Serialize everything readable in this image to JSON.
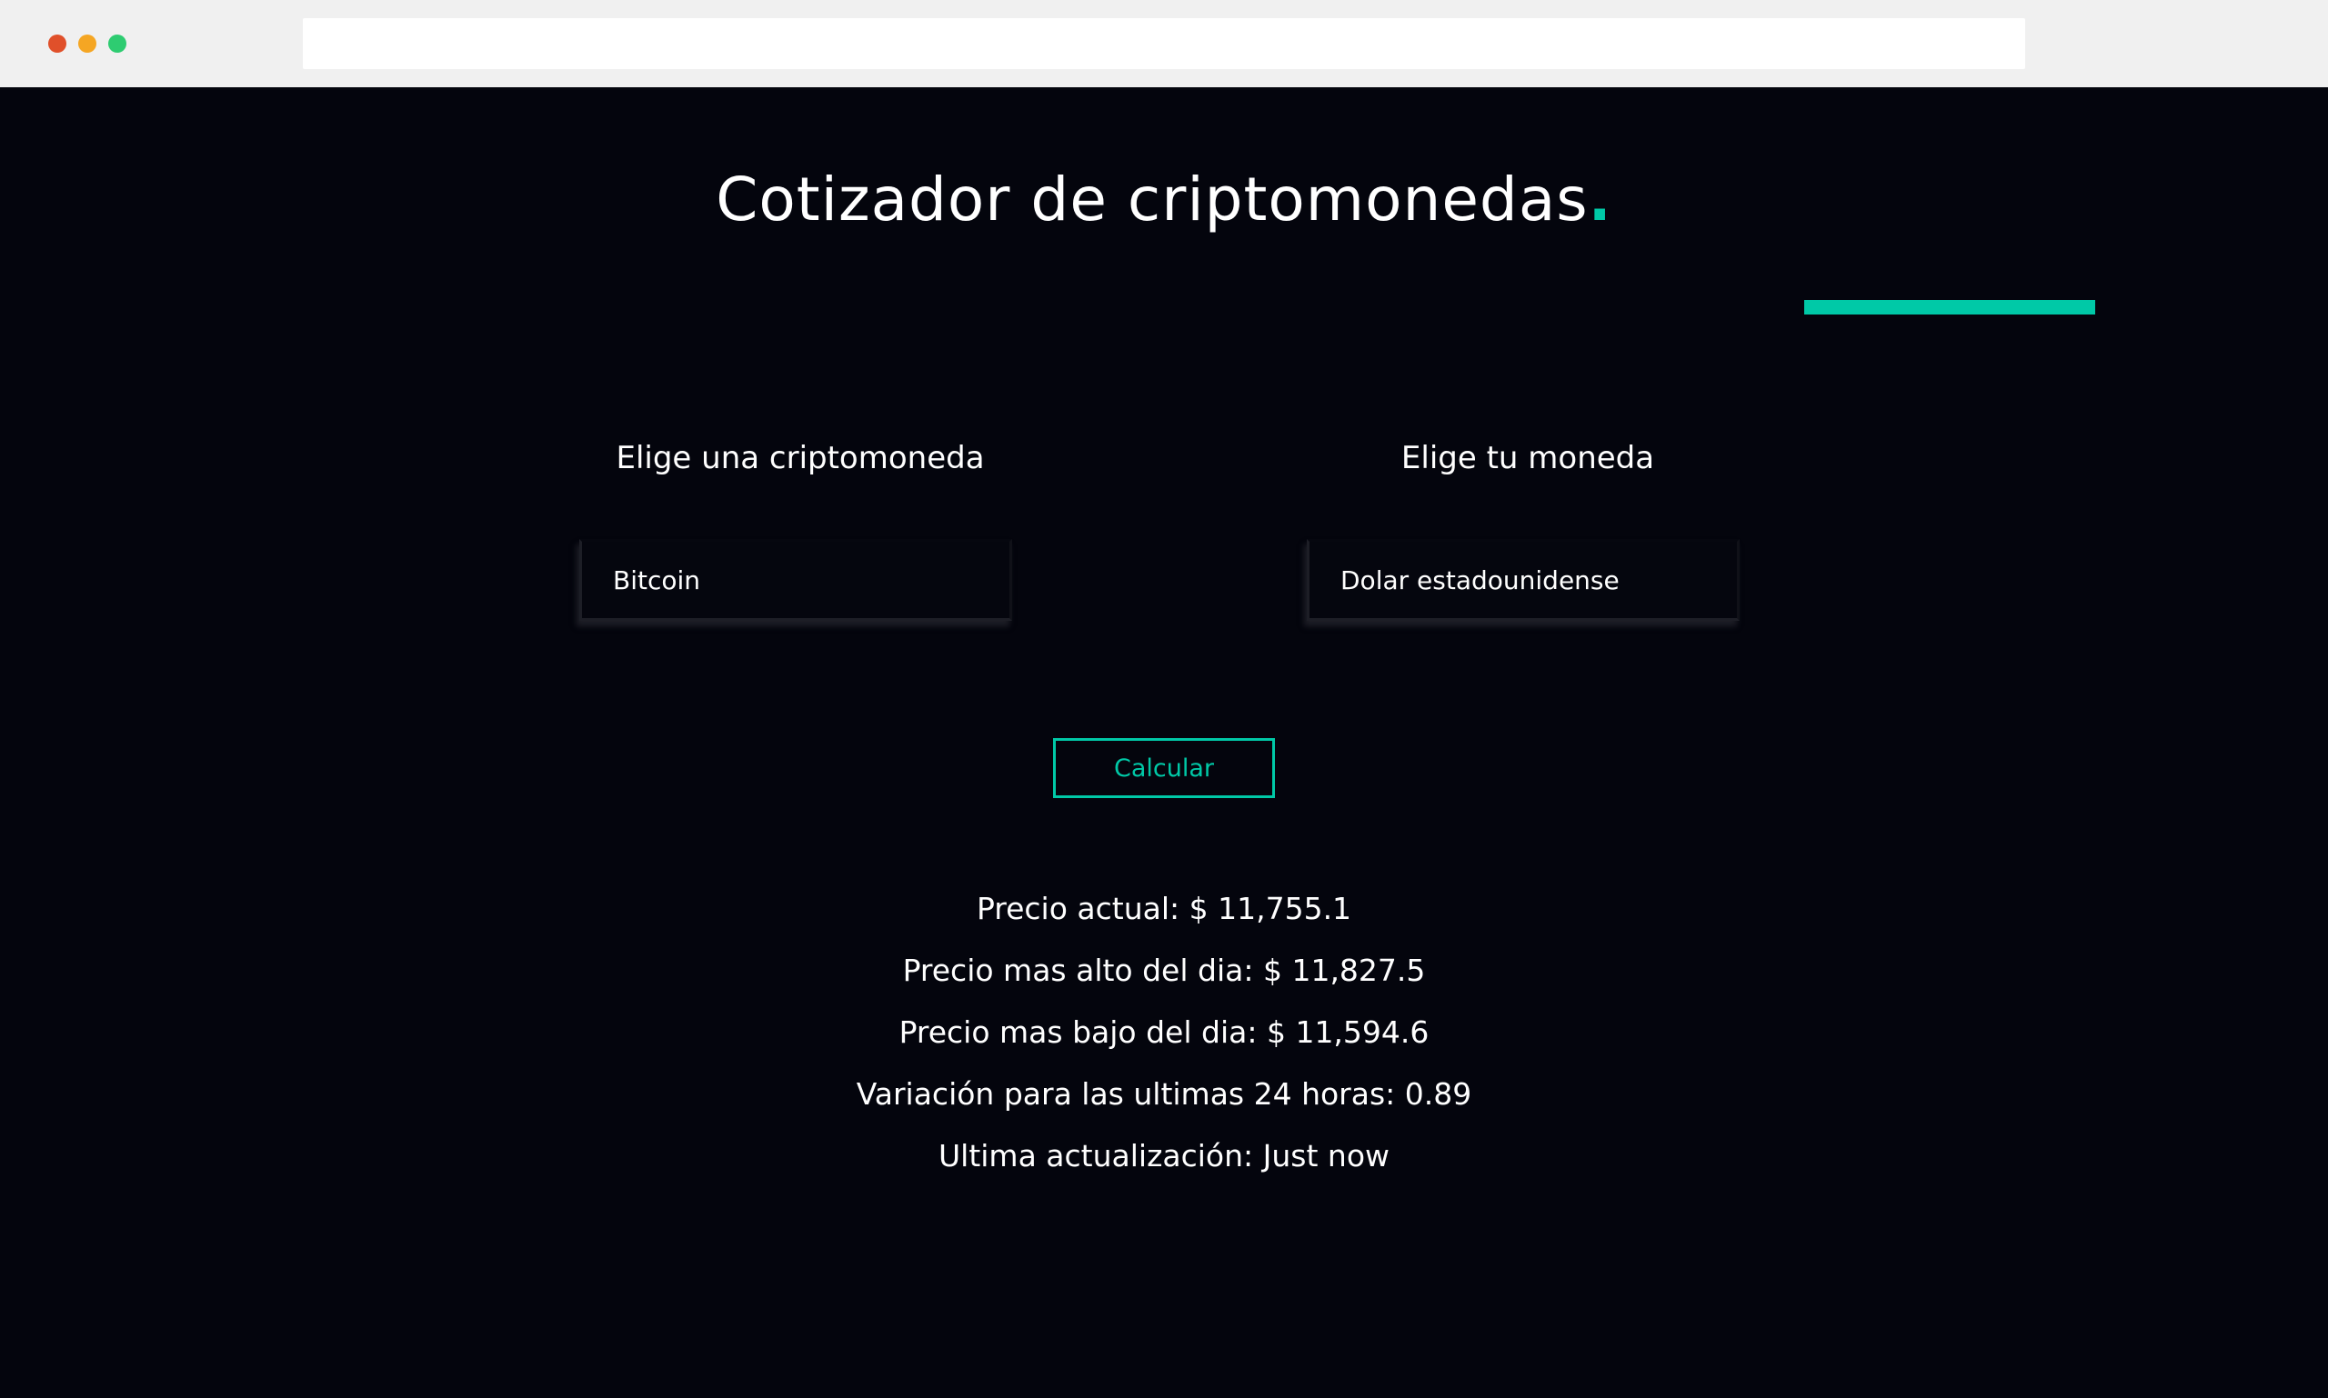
{
  "colors": {
    "page_background": "#04050d",
    "accent": "#00c9a7",
    "chrome_background": "#f0f0f0",
    "dot_red": "#e0502a",
    "dot_yellow": "#f5a623",
    "dot_green": "#2ecc71"
  },
  "header": {
    "title": "Cotizador de criptomonedas",
    "title_dot": "."
  },
  "form": {
    "crypto_label": "Elige una criptomoneda",
    "crypto_value": "Bitcoin",
    "currency_label": "Elige tu moneda",
    "currency_value": "Dolar estadounidense",
    "submit_label": "Calcular"
  },
  "results": [
    "Precio actual: $ 11,755.1",
    "Precio mas alto del dia: $ 11,827.5",
    "Precio mas bajo del dia: $ 11,594.6",
    "Variación para las ultimas 24 horas: 0.89",
    "Ultima actualización: Just now"
  ]
}
